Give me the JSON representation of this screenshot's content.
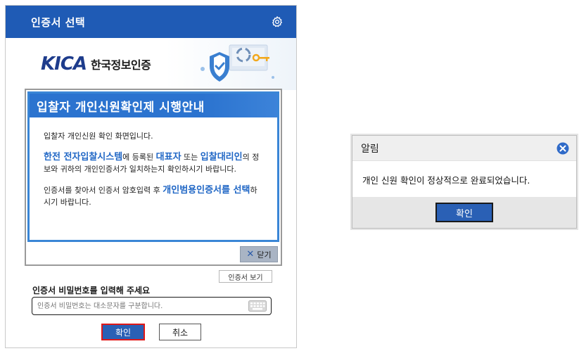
{
  "cert_dialog": {
    "title": "인증서 선택",
    "logo": {
      "mark": "KICA",
      "text": "한국정보인증"
    },
    "notice": {
      "heading": "입찰자 개인신원확인제 시행안내",
      "line1": "입찰자 개인신원 확인 화면입니다.",
      "p2_hl1": "한전 전자입찰시스템",
      "p2_t1": "에 등록된 ",
      "p2_hl2": "대표자",
      "p2_t2": " 또는 ",
      "p2_hl3": "입찰대리인",
      "p2_t3": "의 정보와 귀하의 개인인증서가 일치하는지 확인하시기 바랍니다.",
      "p3_t1": "인증서를 찾아서 인증서 암호입력 후 ",
      "p3_hl1": "개인범용인증서를 선택",
      "p3_t2": "하시기 바랍니다.",
      "close_label": "닫기"
    },
    "view_cert_label": "인증서 보기",
    "password_label": "인증서 비밀번호를 입력해 주세요",
    "password_placeholder": "인증서 비밀번호는 대소문자를 구분합니다.",
    "ok_label": "확인",
    "cancel_label": "취소"
  },
  "alert": {
    "title": "알림",
    "message": "개인 신원 확인이 정상적으로 완료되었습니다.",
    "ok_label": "확인"
  },
  "colors": {
    "titlebar": "#1f5bb5",
    "notice_head": "#2b73cf",
    "highlight": "#1f66c5",
    "ok_border": "#e01818"
  },
  "icons": [
    "gear-icon",
    "shield-icon",
    "key-icon",
    "close-x-icon",
    "keyboard-icon",
    "alert-close-icon"
  ]
}
